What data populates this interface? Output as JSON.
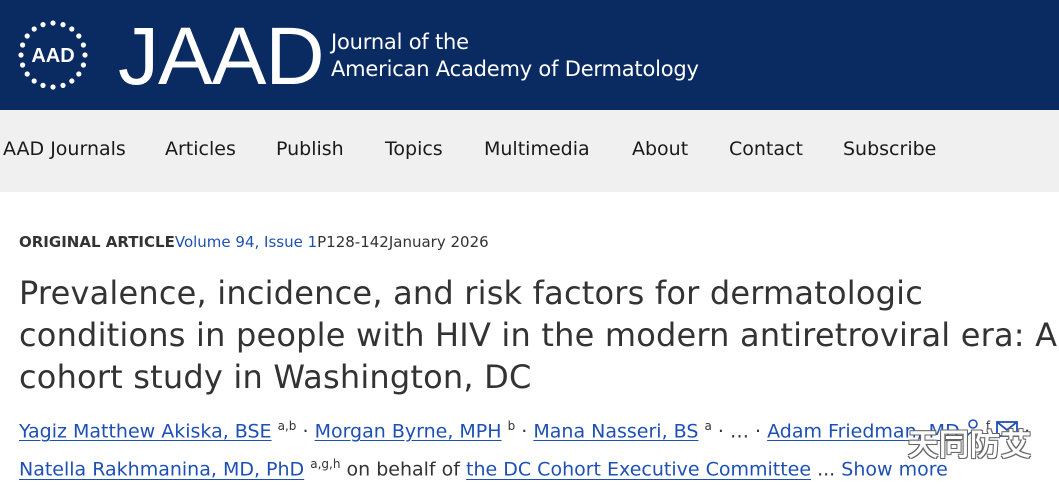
{
  "header": {
    "badge_text": "AAD",
    "journal_abbr": "JAAD",
    "journal_name_line1": "Journal of the",
    "journal_name_line2": "American Academy of Dermatology",
    "background_color": "#0a2a62"
  },
  "nav": {
    "items": [
      {
        "label": "AAD Journals"
      },
      {
        "label": "Articles"
      },
      {
        "label": "Publish"
      },
      {
        "label": "Topics"
      },
      {
        "label": "Multimedia"
      },
      {
        "label": "About"
      },
      {
        "label": "Contact"
      },
      {
        "label": "Subscribe"
      }
    ]
  },
  "article": {
    "type": "ORIGINAL ARTICLE",
    "volume_issue": "Volume 94, Issue 1",
    "pages": "P128-142",
    "date": "January 2026",
    "title": "Prevalence, incidence, and risk factors for dermatologic conditions in people with HIV in the modern antiretroviral era: A cohort study in Washington, DC",
    "authors": [
      {
        "name": "Yagiz Matthew Akiska, BSE",
        "affil": "a,b"
      },
      {
        "name": "Morgan Byrne, MPH",
        "affil": "b"
      },
      {
        "name": "Mana Nasseri, BS",
        "affil": "a"
      },
      {
        "name": "Adam Friedman, MD",
        "affil": "f"
      },
      {
        "name": "Natella Rakhmanina, MD, PhD",
        "affil": "a,g,h"
      }
    ],
    "ellipsis": "…",
    "on_behalf": "on behalf of",
    "committee": "the DC Cohort Executive Committee",
    "more_ellipsis": "...",
    "show_more": "Show more"
  },
  "watermark": "天同防艾",
  "colors": {
    "link": "#1e50b4",
    "text": "#333333",
    "nav_bg": "#f0f0f0"
  }
}
